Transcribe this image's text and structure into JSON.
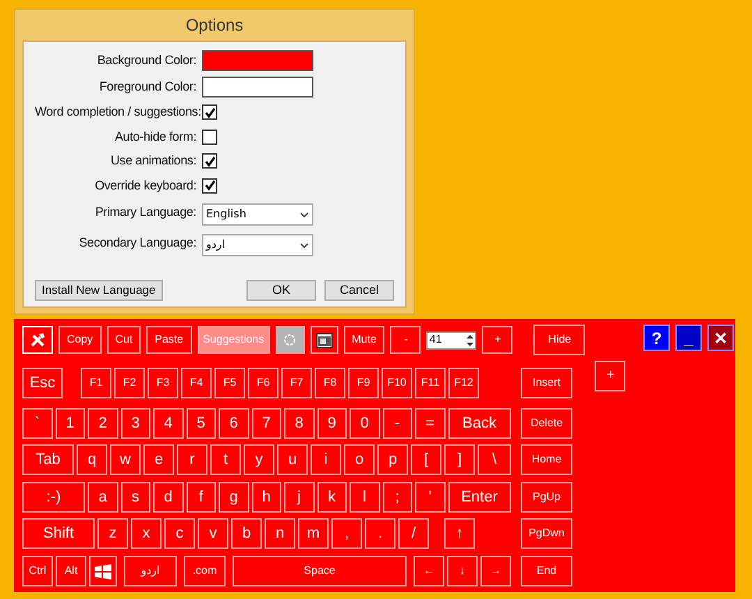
{
  "dialog": {
    "title": "Options",
    "fields": [
      {
        "kind": "color",
        "label": "Background Color:",
        "color": "#ff0000"
      },
      {
        "kind": "color",
        "label": "Foreground Color:",
        "color": "#ffffff"
      },
      {
        "kind": "checkbox",
        "label": "Word completion / suggestions:",
        "checked": true
      },
      {
        "kind": "checkbox",
        "label": "Auto-hide form:",
        "checked": false
      },
      {
        "kind": "checkbox",
        "label": "Use animations:",
        "checked": true
      },
      {
        "kind": "checkbox",
        "label": "Override keyboard:",
        "checked": true
      },
      {
        "kind": "select",
        "label": "Primary Language:",
        "value": "English"
      },
      {
        "kind": "select",
        "label": "Secondary Language:",
        "value": "اردو"
      }
    ],
    "buttons": [
      "Install New Language",
      "OK",
      "Cancel"
    ]
  },
  "keyboard": {
    "toolbar": [
      {
        "kind": "tools"
      },
      {
        "kind": "button",
        "label": "Copy"
      },
      {
        "kind": "button",
        "label": "Cut"
      },
      {
        "kind": "button",
        "label": "Paste"
      },
      {
        "kind": "toggle",
        "label": "Suggestions",
        "on": true
      },
      {
        "kind": "target",
        "on": true
      },
      {
        "kind": "screen"
      },
      {
        "kind": "button",
        "label": "Mute"
      },
      {
        "kind": "button",
        "label": "-"
      },
      {
        "kind": "spinner",
        "value": "41"
      },
      {
        "kind": "button",
        "label": "+"
      }
    ],
    "toolbar_side": "Hide",
    "window_buttons": [
      {
        "kind": "help",
        "label": "?"
      },
      {
        "kind": "minimize",
        "label": "_"
      },
      {
        "kind": "close",
        "label": "✕"
      }
    ],
    "extra_key": "+",
    "rows": [
      {
        "keys": [
          "Esc",
          "F1",
          "F2",
          "F3",
          "F4",
          "F5",
          "F6",
          "F7",
          "F8",
          "F9",
          "F10",
          "F11",
          "F12"
        ],
        "side": "Insert"
      },
      {
        "keys": [
          "`",
          "1",
          "2",
          "3",
          "4",
          "5",
          "6",
          "7",
          "8",
          "9",
          "0",
          "-",
          "=",
          "Back"
        ],
        "side": "Delete"
      },
      {
        "keys": [
          "Tab",
          "q",
          "w",
          "e",
          "r",
          "t",
          "y",
          "u",
          "i",
          "o",
          "p",
          "[",
          "]",
          "\\"
        ],
        "side": "Home"
      },
      {
        "keys": [
          ":-)",
          "a",
          "s",
          "d",
          "f",
          "g",
          "h",
          "j",
          "k",
          "l",
          ";",
          "'",
          "Enter"
        ],
        "side": "PgUp"
      },
      {
        "keys": [
          "Shift",
          "z",
          "x",
          "c",
          "v",
          "b",
          "n",
          "m",
          ",",
          ".",
          "/",
          "↑"
        ],
        "side": "PgDwn"
      },
      {
        "keys": [
          {
            "kind": "text",
            "label": "Ctrl"
          },
          {
            "kind": "text",
            "label": "Alt"
          },
          {
            "kind": "windows"
          },
          {
            "kind": "text",
            "label": "اردو"
          },
          {
            "kind": "text",
            "label": ".com"
          },
          {
            "kind": "text",
            "label": "Space"
          },
          {
            "kind": "text",
            "label": "←"
          },
          {
            "kind": "text",
            "label": "↓"
          },
          {
            "kind": "text",
            "label": "→"
          }
        ],
        "side": "End"
      }
    ]
  }
}
